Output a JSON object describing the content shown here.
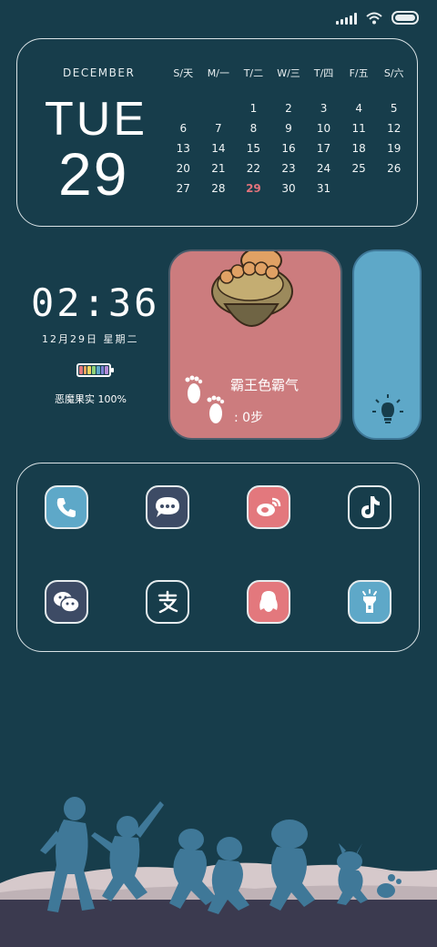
{
  "status_bar": {
    "icons": [
      "signal-icon",
      "wifi-icon",
      "battery-icon"
    ]
  },
  "calendar": {
    "month": "DECEMBER",
    "weekday": "TUE",
    "day": "29",
    "headers": [
      "S/天",
      "M/一",
      "T/二",
      "W/三",
      "T/四",
      "F/五",
      "S/六"
    ],
    "weeks": [
      [
        "",
        "",
        "1",
        "2",
        "3",
        "4",
        "5"
      ],
      [
        "6",
        "7",
        "8",
        "9",
        "10",
        "11",
        "12"
      ],
      [
        "13",
        "14",
        "15",
        "16",
        "17",
        "18",
        "19"
      ],
      [
        "20",
        "21",
        "22",
        "23",
        "24",
        "25",
        "26"
      ],
      [
        "27",
        "28",
        "29",
        "30",
        "31",
        "",
        ""
      ]
    ],
    "today": "29"
  },
  "clock": {
    "time": "02:36",
    "date": "12月29日 星期二",
    "battery_label": "恶魔果实 100%",
    "battery_level": 100
  },
  "step_widget": {
    "title": "霸王色霸气",
    "steps": ": 0步"
  },
  "torch_widget": {
    "icon": "lightbulb-icon"
  },
  "apps": [
    {
      "name": "phone",
      "icon": "phone-icon",
      "bg": "#5ea8c8"
    },
    {
      "name": "messages",
      "icon": "chat-bubble-icon",
      "bg": "#3d4b65"
    },
    {
      "name": "weibo",
      "icon": "weibo-icon",
      "bg": "#e3787d"
    },
    {
      "name": "tiktok",
      "icon": "tiktok-icon",
      "bg": "#173d4b"
    },
    {
      "name": "wechat",
      "icon": "wechat-icon",
      "bg": "#3d4b65"
    },
    {
      "name": "alipay",
      "icon": "alipay-icon",
      "bg": "#173d4b"
    },
    {
      "name": "qq",
      "icon": "qq-penguin-icon",
      "bg": "#e3787d"
    },
    {
      "name": "flashlight",
      "icon": "flashlight-icon",
      "bg": "#5ea8c8"
    }
  ],
  "colors": {
    "background": "#173d4b",
    "accent_blue": "#5ea8c8",
    "accent_pink": "#e3787d",
    "accent_navy": "#3d4b65",
    "today": "#e2737b"
  }
}
